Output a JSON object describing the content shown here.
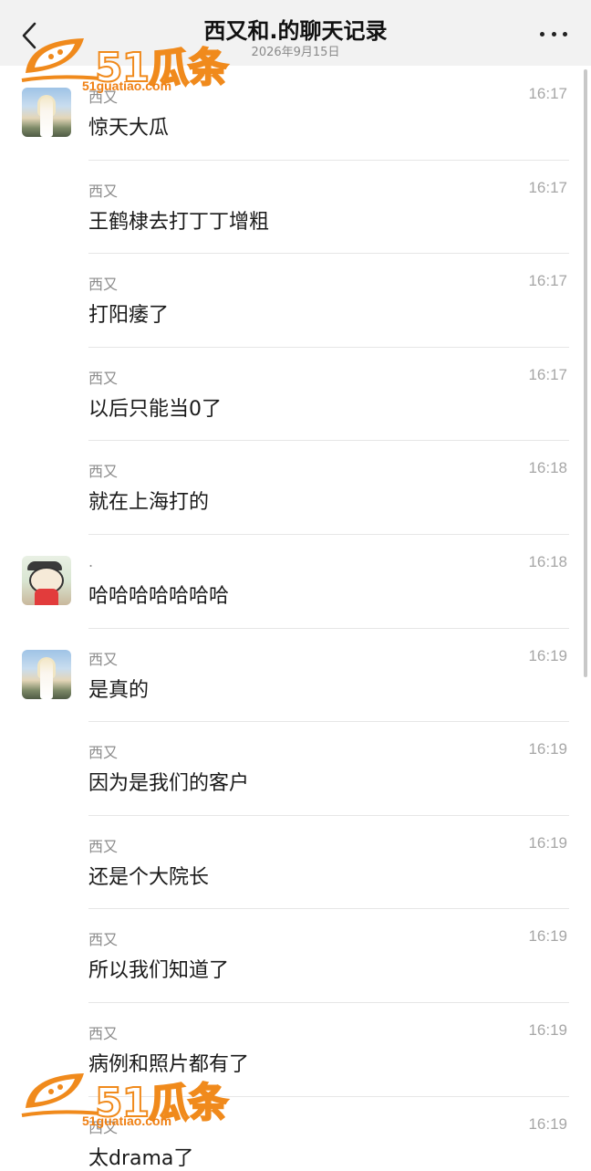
{
  "header": {
    "title": "西又和.的聊天记录",
    "subtitle": "2026年9月15日"
  },
  "messages": [
    {
      "sender": "西又",
      "time": "16:17",
      "text": "惊天大瓜",
      "avatar": "girl"
    },
    {
      "sender": "西又",
      "time": "16:17",
      "text": "王鹤棣去打丁丁增粗",
      "avatar": ""
    },
    {
      "sender": "西又",
      "time": "16:17",
      "text": "打阳痿了",
      "avatar": ""
    },
    {
      "sender": "西又",
      "time": "16:17",
      "text": "以后只能当0了",
      "avatar": ""
    },
    {
      "sender": "西又",
      "time": "16:18",
      "text": "就在上海打的",
      "avatar": ""
    },
    {
      "sender": ".",
      "time": "16:18",
      "text": "哈哈哈哈哈哈哈",
      "avatar": "cartoon"
    },
    {
      "sender": "西又",
      "time": "16:19",
      "text": "是真的",
      "avatar": "girl"
    },
    {
      "sender": "西又",
      "time": "16:19",
      "text": "因为是我们的客户",
      "avatar": ""
    },
    {
      "sender": "西又",
      "time": "16:19",
      "text": "还是个大院长",
      "avatar": ""
    },
    {
      "sender": "西又",
      "time": "16:19",
      "text": "所以我们知道了",
      "avatar": ""
    },
    {
      "sender": "西又",
      "time": "16:19",
      "text": "病例和照片都有了",
      "avatar": ""
    },
    {
      "sender": "西又",
      "time": "16:19",
      "text": "太drama了",
      "avatar": ""
    }
  ],
  "watermark": {
    "brand": "51瓜条",
    "url": "51guatiao.com"
  },
  "colors": {
    "header_bg": "#f2f2f2",
    "watermark": "#f08a1c"
  },
  "icons": {
    "back": "chevron-left-icon",
    "more": "ellipsis-icon"
  }
}
